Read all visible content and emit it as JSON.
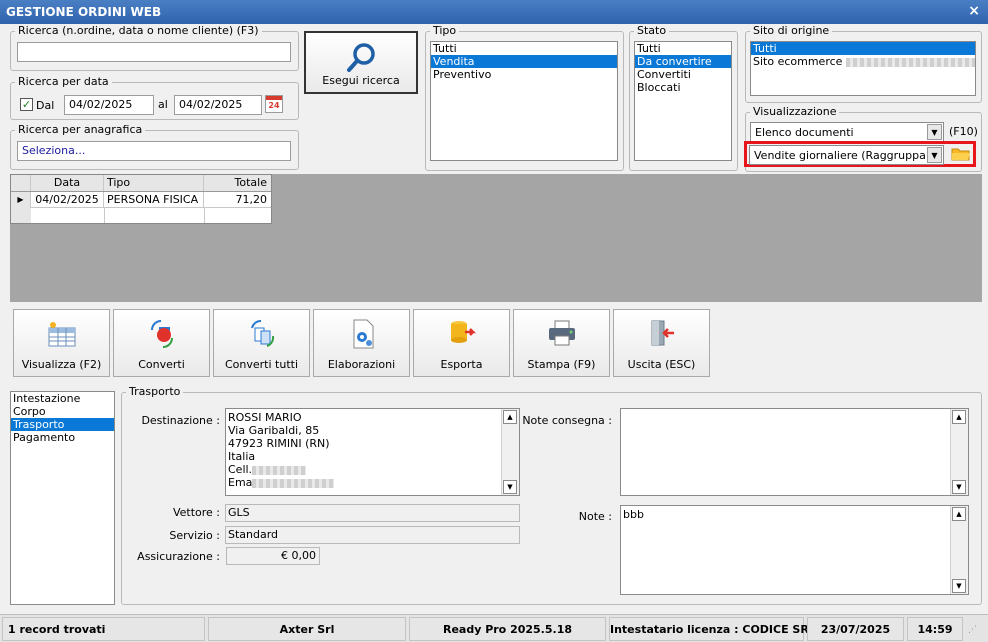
{
  "window": {
    "title": "GESTIONE ORDINI WEB",
    "close_glyph": "×"
  },
  "search": {
    "label": "Ricerca (n.ordine, data o nome cliente) (F3)",
    "value": "",
    "button_label": "Esegui ricerca"
  },
  "date_search": {
    "label": "Ricerca per data",
    "from_label": "Dal",
    "from_checked": true,
    "from_value": "04/02/2025",
    "to_label": "al",
    "to_value": "04/02/2025",
    "calendar_day": "24"
  },
  "registry_search": {
    "label": "Ricerca per anagrafica",
    "value": "Seleziona..."
  },
  "tipo": {
    "label": "Tipo",
    "items": [
      "Tutti",
      "Vendita",
      "Preventivo"
    ],
    "selected": 1
  },
  "stato": {
    "label": "Stato",
    "items": [
      "Tutti",
      "Da convertire",
      "Convertiti",
      "Bloccati"
    ],
    "selected": 1
  },
  "sito": {
    "label": "Sito di origine",
    "items": [
      "Tutti",
      "Sito ecommerce"
    ],
    "selected": 0
  },
  "visualizzazione": {
    "label": "Visualizzazione",
    "combo1": "Elenco documenti",
    "combo1_shortcut": "(F10)",
    "combo2": "Vendite giornaliere (Raggruppamenti)",
    "highlight_color": "#e8161b"
  },
  "grid": {
    "columns": [
      "Data",
      "Tipo",
      "Totale"
    ],
    "rows": [
      {
        "data": "04/02/2025",
        "tipo": "PERSONA FISICA",
        "totale": "71,20"
      }
    ]
  },
  "toolbar": {
    "buttons": [
      {
        "label": "Visualizza (F2)",
        "icon": "table-view-icon"
      },
      {
        "label": "Converti",
        "icon": "convert-icon"
      },
      {
        "label": "Converti tutti",
        "icon": "convert-all-icon"
      },
      {
        "label": "Elaborazioni",
        "icon": "process-icon"
      },
      {
        "label": "Esporta",
        "icon": "export-icon"
      },
      {
        "label": "Stampa (F9)",
        "icon": "printer-icon"
      },
      {
        "label": "Uscita (ESC)",
        "icon": "exit-door-icon"
      }
    ]
  },
  "sections": {
    "items": [
      "Intestazione",
      "Corpo",
      "Trasporto",
      "Pagamento"
    ],
    "selected": 2
  },
  "trasporto": {
    "label": "Trasporto",
    "destinazione_label": "Destinazione :",
    "destinazione_lines": [
      "ROSSI MARIO",
      "Via Garibaldi, 85",
      "47923 RIMINI (RN)",
      "Italia",
      "Cell.",
      "Ema"
    ],
    "vettore_label": "Vettore :",
    "vettore": "GLS",
    "servizio_label": "Servizio :",
    "servizio": "Standard",
    "assicurazione_label": "Assicurazione :",
    "assicurazione": "€ 0,00",
    "note_consegna_label": "Note consegna :",
    "note_consegna": "",
    "note_label": "Note :",
    "note": "bbb"
  },
  "status": {
    "records": "1 record trovati",
    "company": "Axter Srl",
    "version": "Ready Pro 2025.5.18",
    "license": "Intestatario licenza : CODICE SRL",
    "date": "23/07/2025",
    "time": "14:59"
  }
}
